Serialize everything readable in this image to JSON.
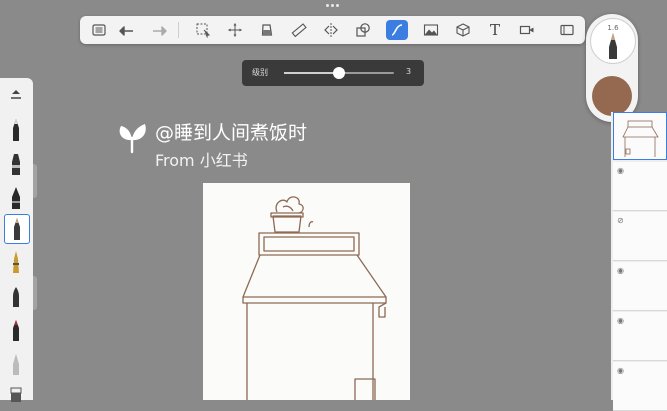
{
  "toolbar": {
    "tools": [
      {
        "name": "menu-list-icon"
      },
      {
        "name": "undo-icon"
      },
      {
        "name": "redo-icon"
      },
      {
        "name": "selection-icon"
      },
      {
        "name": "transform-icon"
      },
      {
        "name": "fill-icon"
      },
      {
        "name": "ruler-icon"
      },
      {
        "name": "symmetry-icon"
      },
      {
        "name": "shapes-icon"
      },
      {
        "name": "stroke-tool-icon",
        "active": true
      },
      {
        "name": "image-icon"
      },
      {
        "name": "perspective-icon"
      },
      {
        "name": "text-icon"
      },
      {
        "name": "video-icon"
      },
      {
        "name": "fullscreen-icon"
      }
    ],
    "text_tool_glyph": "T"
  },
  "slider": {
    "label": "级别",
    "value": "3",
    "fraction": 0.5
  },
  "brush_puck": {
    "size": "1.6",
    "color": "#94694f"
  },
  "watermark": {
    "handle": "@睡到人间煮饭时",
    "source": "From 小红书"
  },
  "colors": {
    "accent": "#3b7de0",
    "stroke": "#8c6a55"
  },
  "layers": [
    {
      "selected": true
    },
    {},
    {},
    {},
    {},
    {}
  ]
}
